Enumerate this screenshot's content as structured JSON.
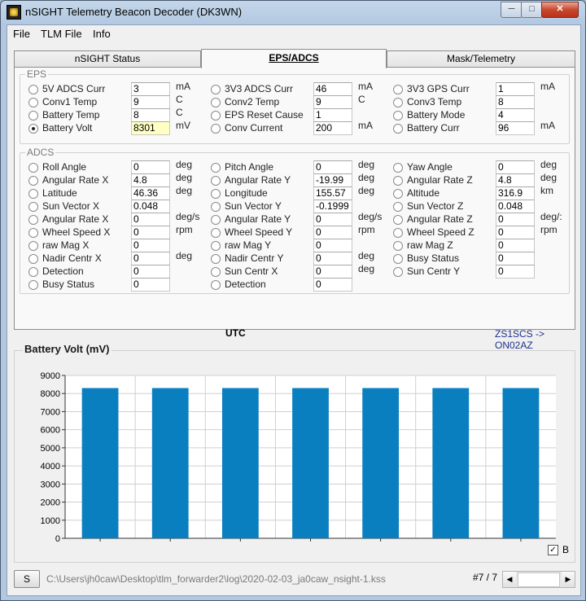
{
  "window": {
    "title": "nSIGHT Telemetry Beacon Decoder (DK3WN)"
  },
  "menu": [
    "File",
    "TLM File",
    "Info"
  ],
  "tabs": [
    {
      "label": "nSIGHT Status"
    },
    {
      "label": "EPS/ADCS"
    },
    {
      "label": "Mask/Telemetry"
    }
  ],
  "eps": {
    "title": "EPS",
    "columns": [
      [
        {
          "label": "5V ADCS Curr",
          "value": "3",
          "unit": "mA"
        },
        {
          "label": "Conv1 Temp",
          "value": "9",
          "unit": "C"
        },
        {
          "label": "Battery Temp",
          "value": "8",
          "unit": "C"
        },
        {
          "label": "Battery Volt",
          "value": "8301",
          "unit": "mV",
          "selected": true,
          "highlight": true
        }
      ],
      [
        {
          "label": "3V3 ADCS Curr",
          "value": "46",
          "unit": "mA"
        },
        {
          "label": "Conv2 Temp",
          "value": "9",
          "unit": "C"
        },
        {
          "label": "EPS Reset Cause",
          "value": "1",
          "unit": ""
        },
        {
          "label": "Conv Current",
          "value": "200",
          "unit": "mA"
        }
      ],
      [
        {
          "label": "3V3 GPS Curr",
          "value": "1",
          "unit": "mA"
        },
        {
          "label": "Conv3 Temp",
          "value": "8",
          "unit": ""
        },
        {
          "label": "Battery Mode",
          "value": "4",
          "unit": ""
        },
        {
          "label": "Battery Curr",
          "value": "96",
          "unit": "mA"
        }
      ]
    ]
  },
  "adcs": {
    "title": "ADCS",
    "columns": [
      [
        {
          "label": "Roll Angle",
          "value": "0",
          "unit": "deg"
        },
        {
          "label": "Angular Rate X",
          "value": "4.8",
          "unit": "deg"
        },
        {
          "label": "Latitude",
          "value": "46.36",
          "unit": "deg"
        },
        {
          "label": "Sun Vector X",
          "value": "0.048",
          "unit": ""
        },
        {
          "label": "Angular Rate X",
          "value": "0",
          "unit": "deg/s"
        },
        {
          "label": "Wheel Speed X",
          "value": "0",
          "unit": "rpm"
        },
        {
          "label": "raw Mag X",
          "value": "0",
          "unit": ""
        },
        {
          "label": "Nadir Centr X",
          "value": "0",
          "unit": "deg"
        },
        {
          "label": "Detection",
          "value": "0",
          "unit": ""
        },
        {
          "label": "Busy Status",
          "value": "0",
          "unit": ""
        }
      ],
      [
        {
          "label": "Pitch Angle",
          "value": "0",
          "unit": "deg"
        },
        {
          "label": "Angular Rate Y",
          "value": "-19.99",
          "unit": "deg"
        },
        {
          "label": "Longitude",
          "value": "155.57",
          "unit": "deg"
        },
        {
          "label": "Sun Vector Y",
          "value": "-0.1999",
          "unit": ""
        },
        {
          "label": "Angular Rate Y",
          "value": "0",
          "unit": "deg/s"
        },
        {
          "label": "Wheel Speed Y",
          "value": "0",
          "unit": "rpm"
        },
        {
          "label": "raw Mag Y",
          "value": "0",
          "unit": ""
        },
        {
          "label": "Nadir Centr Y",
          "value": "0",
          "unit": "deg"
        },
        {
          "label": "Sun Centr X",
          "value": "0",
          "unit": "deg"
        },
        {
          "label": "Detection",
          "value": "0",
          "unit": ""
        }
      ],
      [
        {
          "label": "Yaw Angle",
          "value": "0",
          "unit": "deg"
        },
        {
          "label": "Angular Rate Z",
          "value": "4.8",
          "unit": "deg"
        },
        {
          "label": "Altitude",
          "value": "316.9",
          "unit": "km"
        },
        {
          "label": "Sun Vector Z",
          "value": "0.048",
          "unit": ""
        },
        {
          "label": "Angular Rate Z",
          "value": "0",
          "unit": "deg/:"
        },
        {
          "label": "Wheel Speed Z",
          "value": "0",
          "unit": "rpm"
        },
        {
          "label": "raw Mag Z",
          "value": "0",
          "unit": ""
        },
        {
          "label": "Busy Status",
          "value": "0",
          "unit": ""
        },
        {
          "label": "Sun Centr Y",
          "value": "0",
          "unit": ""
        }
      ]
    ]
  },
  "utc_label": "UTC",
  "callsign": "ZS1SCS -> ON02AZ",
  "chart_data": {
    "type": "bar",
    "title": "Battery Volt (mV)",
    "categories": [
      "",
      "",
      "",
      "",
      "",
      "",
      ""
    ],
    "series": [
      {
        "name": "B",
        "values": [
          8301,
          8301,
          8301,
          8301,
          8301,
          8301,
          8301
        ]
      }
    ],
    "ylim": [
      0,
      9000
    ],
    "yticks": [
      0,
      1000,
      2000,
      3000,
      4000,
      5000,
      6000,
      7000,
      8000,
      9000
    ],
    "grid": true,
    "bar_color": "#0a7fc0",
    "legend": "bottom-right"
  },
  "legend": {
    "label": "B",
    "checked": "✓"
  },
  "status": {
    "button_label": "S",
    "path": "C:\\Users\\jh0caw\\Desktop\\tlm_forwarder2\\log\\2020-02-03_ja0caw_nsight-1.kss",
    "counter": "#7 / 7",
    "left_arrow": "◀",
    "right_arrow": "▶"
  }
}
